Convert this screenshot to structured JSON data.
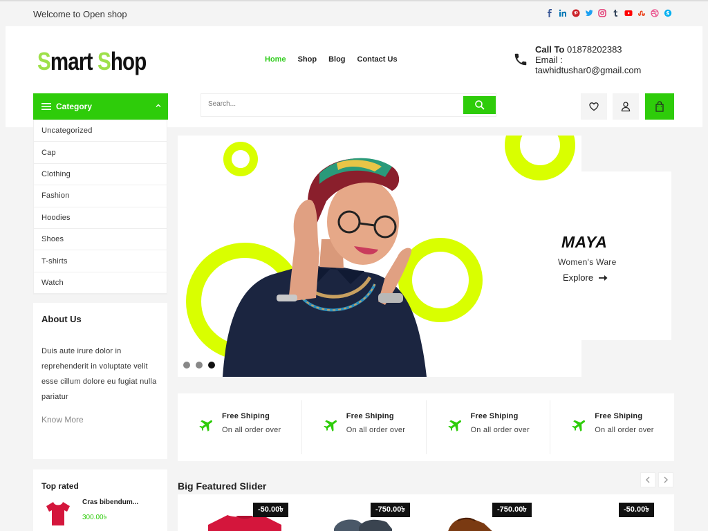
{
  "topbar": {
    "welcome": "Welcome to Open shop",
    "socials": [
      "facebook-icon",
      "linkedin-icon",
      "pinterest-icon",
      "twitter-icon",
      "instagram-icon",
      "tumblr-icon",
      "youtube-icon",
      "stumbleupon-icon",
      "dribbble-icon",
      "skype-icon"
    ]
  },
  "header": {
    "logo_first_cap": "S",
    "logo_first_rest": "mart ",
    "logo_second_cap": "S",
    "logo_second_rest": "hop",
    "nav": [
      "Home",
      "Shop",
      "Blog",
      "Contact Us"
    ],
    "contact": {
      "call_label": "Call To",
      "phone": "01878202383",
      "email_label": "Email :",
      "email": "tawhidtushar0@gmail.com"
    },
    "category_label": "Category",
    "search_placeholder": "Search..."
  },
  "categories": [
    "Uncategorized",
    "Cap",
    "Clothing",
    "Fashion",
    "Hoodies",
    "Shoes",
    "T-shirts",
    "Watch"
  ],
  "about": {
    "title": "About Us",
    "text": "Duis aute irure dolor in reprehenderit in voluptate velit esse cillum dolore eu fugiat nulla pariatur",
    "more": "Know More"
  },
  "top_rated": {
    "title": "Top rated",
    "product_name": "Cras bibendum...",
    "product_price": "300.00৳"
  },
  "hero": {
    "title": "MAYA",
    "subtitle": "Women's Ware",
    "cta": "Explore"
  },
  "features": [
    {
      "title": "Free Shiping",
      "sub": "On all order over"
    },
    {
      "title": "Free Shiping",
      "sub": "On all order over"
    },
    {
      "title": "Free Shiping",
      "sub": "On all order over"
    },
    {
      "title": "Free Shiping",
      "sub": "On all order over"
    }
  ],
  "featured": {
    "title": "Big Featured Slider",
    "badges": [
      "-50.00৳",
      "-750.00৳",
      "-750.00৳",
      "-50.00৳"
    ]
  },
  "colors": {
    "accent": "#2ecc0a",
    "lime": "#d9ff00",
    "logo_green": "#9ee04a"
  }
}
